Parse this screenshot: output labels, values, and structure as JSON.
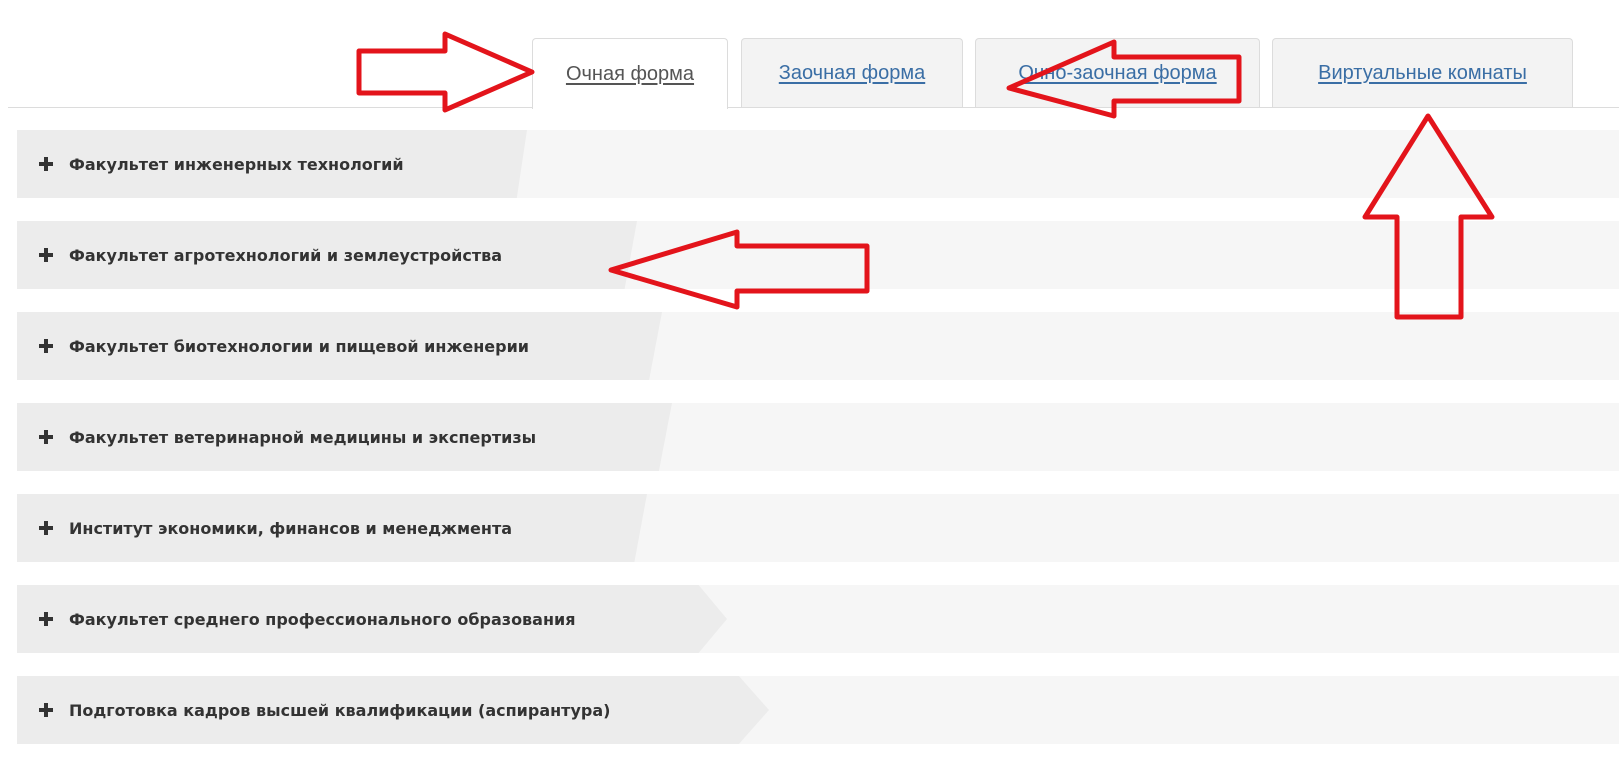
{
  "tabs": [
    {
      "label": "Очная форма",
      "active": true
    },
    {
      "label": "Заочная форма",
      "active": false
    },
    {
      "label": "Очно-заочная форма",
      "active": false
    },
    {
      "label": "Виртуальные комнаты",
      "active": false
    }
  ],
  "faculties": [
    {
      "label": "Факультет инженерных технологий"
    },
    {
      "label": "Факультет агротехнологий и землеустройства"
    },
    {
      "label": "Факультет биотехнологии и пищевой инженерии"
    },
    {
      "label": "Факультет ветеринарной медицины и экспертизы"
    },
    {
      "label": "Институт экономики, финансов и менеджмента"
    },
    {
      "label": "Факультет среднего профессионального образования"
    },
    {
      "label": "Подготовка кадров высшей квалификации (аспирантура)"
    }
  ],
  "icons": {
    "row_expand": "plus-icon"
  },
  "colors": {
    "link": "#3a6ea5",
    "active_tab_text": "#555555",
    "annotation_arrow": "#e3141b",
    "row_background": "#f6f6f6",
    "row_shade": "#ececec"
  }
}
